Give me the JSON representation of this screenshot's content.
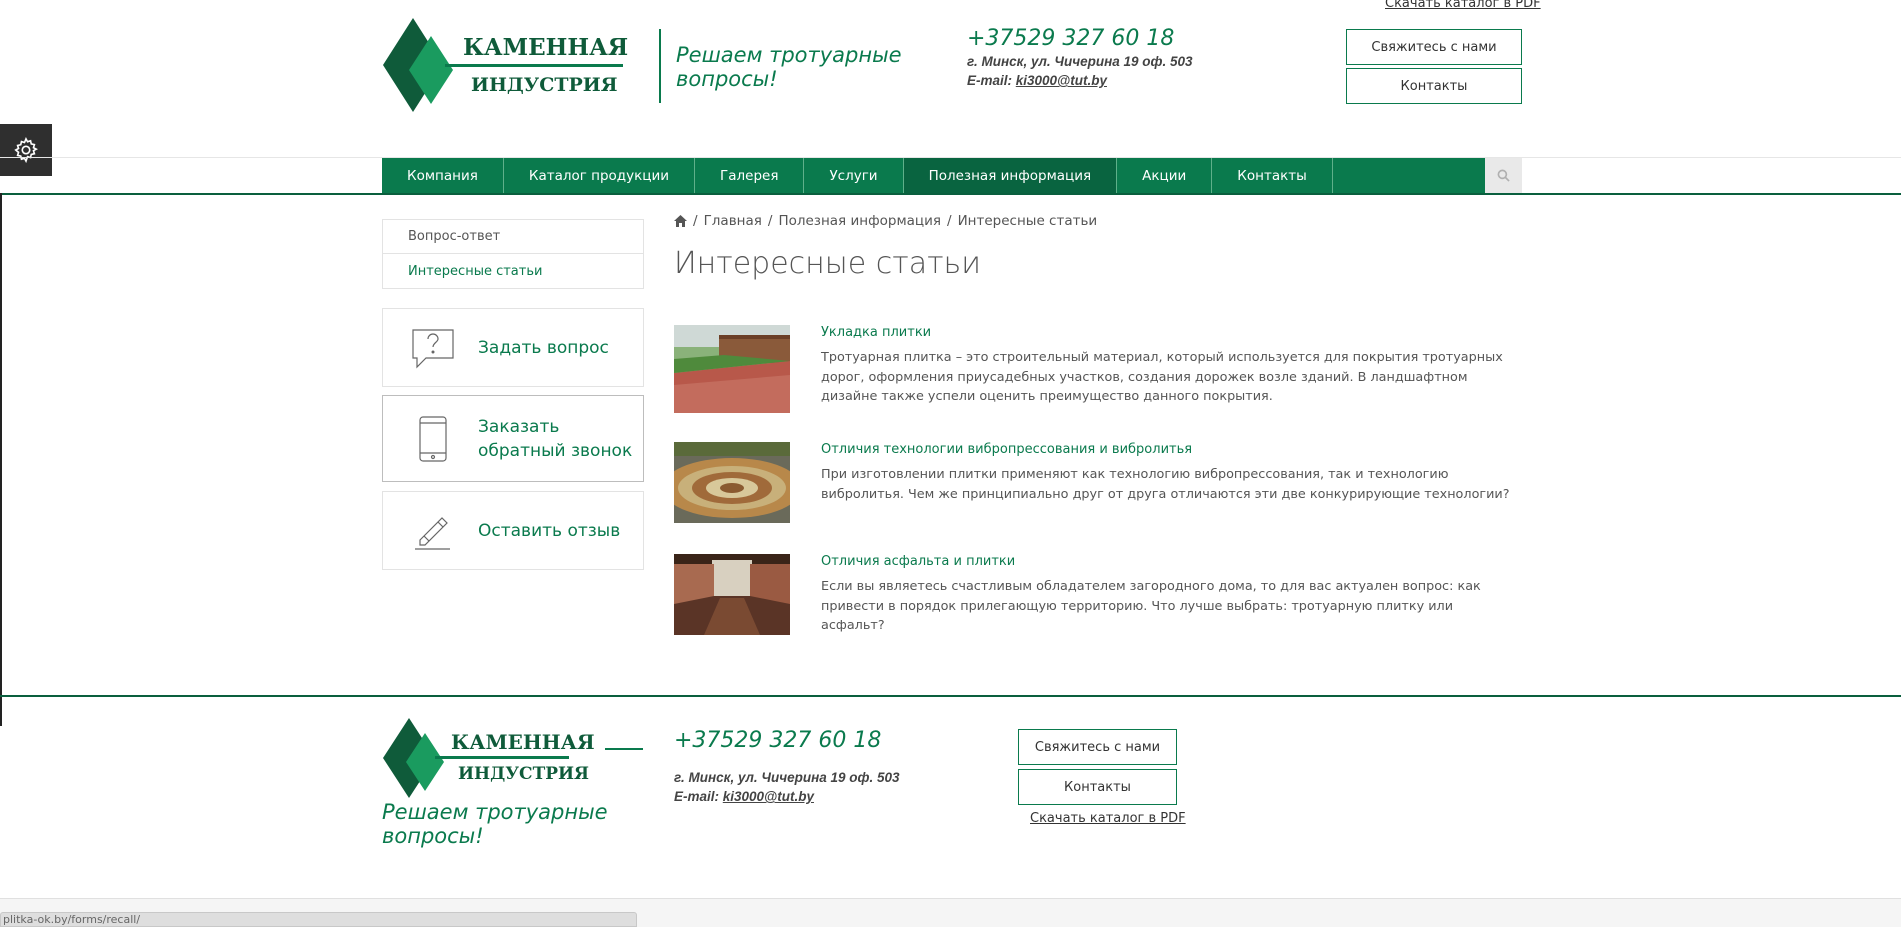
{
  "header": {
    "logo_line1": "КАМЕННАЯ",
    "logo_line2": "ИНДУСТРИЯ",
    "slogan_line1": "Решаем тротуарные",
    "slogan_line2": "вопросы!",
    "phone": "+37529 327 60 18",
    "address": "г. Минск, ул. Чичерина 19 оф. 503",
    "email_label": "E-mail: ",
    "email": "ki3000@tut.by",
    "catalog_link": "Скачать каталог в PDF",
    "contact_us_button": "Свяжитесь с нами",
    "contacts_button": "Контакты"
  },
  "nav": {
    "items": [
      {
        "label": "Компания"
      },
      {
        "label": "Каталог продукции"
      },
      {
        "label": "Галерея"
      },
      {
        "label": "Услуги"
      },
      {
        "label": "Полезная информация"
      },
      {
        "label": "Акции"
      },
      {
        "label": "Контакты"
      }
    ],
    "active_index": 4
  },
  "sidebar": {
    "menu": [
      {
        "label": "Вопрос-ответ"
      },
      {
        "label": "Интересные статьи"
      }
    ],
    "cards": {
      "ask": {
        "line1": "Задать вопрос",
        "line2": ""
      },
      "callback": {
        "line1": "Заказать",
        "line2": "обратный звонок"
      },
      "review": {
        "line1": "Оставить отзыв",
        "line2": ""
      }
    }
  },
  "breadcrumb": {
    "items": [
      "Главная",
      "Полезная информация",
      "Интересные статьи"
    ],
    "separator": "/"
  },
  "page": {
    "title": "Интересные статьи"
  },
  "articles": [
    {
      "title": "Укладка плитки",
      "description": "Тротуарная плитка – это строительный материал, который используется для покрытия тротуарных дорог, оформления приусадебных участков, создания дорожек возле зданий. В ландшафтном дизайне также успели оценить преимущество данного покрытия."
    },
    {
      "title": "Отличия технологии вибропрессования и вибролитья",
      "description": "При изготовлении плитки применяют как технологию вибропрессования, так и технологию вибролитья. Чем же принципиально друг от друга отличаются эти две конкурирующие технологии?"
    },
    {
      "title": "Отличия асфальта и плитки",
      "description": "Если вы являетесь счастливым обладателем загородного дома, то для вас актуален вопрос: как привести в порядок прилегающую территорию. Что лучше выбрать: тротуарную плитку или асфальт?"
    }
  ],
  "footer": {
    "logo_line1": "КАМЕННАЯ",
    "logo_line2": "ИНДУСТРИЯ",
    "slogan_line1": "Решаем тротуарные",
    "slogan_line2": "вопросы!",
    "phone": "+37529 327 60 18",
    "address": "г. Минск, ул. Чичерина 19 оф. 503",
    "email_label": "E-mail: ",
    "email": "ki3000@tut.by",
    "contact_us_button": "Свяжитесь с нами",
    "contacts_button": "Контакты",
    "catalog_link": "Скачать каталог в PDF"
  },
  "statusbar": {
    "url": "plitka-ok.by/forms/recall/"
  },
  "colors": {
    "brand_green": "#0a7a4d",
    "nav_active": "#096440",
    "dark_green": "#0f5b3a"
  },
  "icons": {
    "settings": "gear-icon",
    "search": "search-icon",
    "home": "home-icon",
    "ask": "question-bubble-icon",
    "callback": "phone-icon",
    "review": "pencil-icon"
  }
}
